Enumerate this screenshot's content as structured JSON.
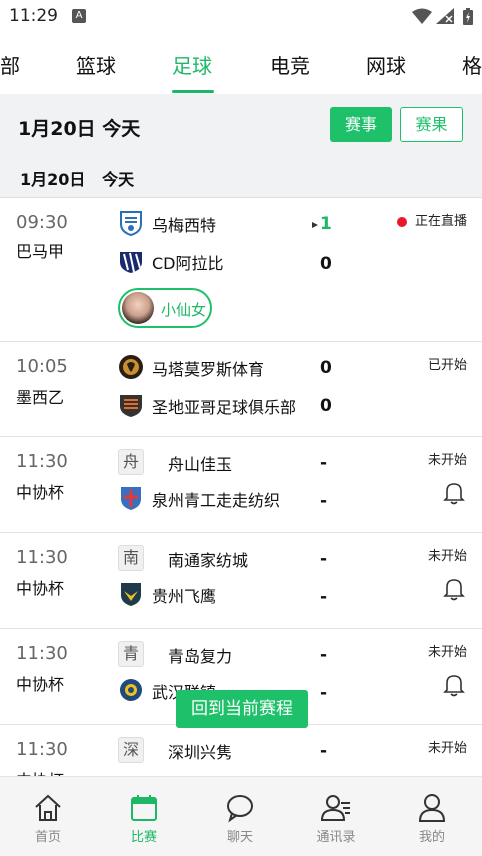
{
  "status_bar": {
    "time": "11:29",
    "notif_icon": "A"
  },
  "sport_tabs": [
    {
      "label": "部",
      "active": false
    },
    {
      "label": "篮球",
      "active": false
    },
    {
      "label": "足球",
      "active": true
    },
    {
      "label": "电竞",
      "active": false
    },
    {
      "label": "网球",
      "active": false
    },
    {
      "label": "格",
      "active": false
    }
  ],
  "date_header": {
    "date": "1月20日 今天",
    "events_button": "赛事",
    "results_button": "赛果"
  },
  "sub_date": "1月20日   今天",
  "matches": [
    {
      "time": "09:30",
      "league": "巴马甲",
      "home": {
        "name": "乌梅西特",
        "logo": "shield-logo"
      },
      "away": {
        "name": "CD阿拉比",
        "logo": "striped-logo"
      },
      "home_score": "1",
      "away_score": "0",
      "status": "正在直播",
      "live": true,
      "streamer": "小仙女"
    },
    {
      "time": "10:05",
      "league": "墨西乙",
      "home": {
        "name": "马塔莫罗斯体育",
        "logo": "lion-logo"
      },
      "away": {
        "name": "圣地亚哥足球俱乐部",
        "logo": "crest-logo"
      },
      "home_score": "0",
      "away_score": "0",
      "status": "已开始"
    },
    {
      "time": "11:30",
      "league": "中协杯",
      "home": {
        "name": "舟山佳玉",
        "logo_char": "舟"
      },
      "away": {
        "name": "泉州青工走走纺织",
        "logo": "crest-logo"
      },
      "home_score": "-",
      "away_score": "-",
      "status": "未开始"
    },
    {
      "time": "11:30",
      "league": "中协杯",
      "home": {
        "name": "南通家纺城",
        "logo_char": "南"
      },
      "away": {
        "name": "贵州飞鹰",
        "logo": "eagle-logo"
      },
      "home_score": "-",
      "away_score": "-",
      "status": "未开始"
    },
    {
      "time": "11:30",
      "league": "中协杯",
      "home": {
        "name": "青岛复力",
        "logo_char": "青"
      },
      "away": {
        "name": "武汉联镇",
        "logo": "circle-logo"
      },
      "home_score": "-",
      "away_score": "-",
      "status": "未开始"
    },
    {
      "time": "11:30",
      "league": "中协杯",
      "home": {
        "name": "深圳兴隽",
        "logo_char": "深"
      },
      "away": {
        "name": "",
        "logo": ""
      },
      "home_score": "-",
      "away_score": "",
      "status": "未开始"
    }
  ],
  "float_button": "回到当前赛程",
  "bottom_nav": [
    {
      "label": "首页",
      "icon": "home-icon"
    },
    {
      "label": "比赛",
      "icon": "calendar-icon",
      "active": true
    },
    {
      "label": "聊天",
      "icon": "chat-icon"
    },
    {
      "label": "通讯录",
      "icon": "contacts-icon"
    },
    {
      "label": "我的",
      "icon": "profile-icon"
    }
  ],
  "colors": {
    "accent": "#1fc06a",
    "live_dot": "#e8182a",
    "header_bg": "#f1f2f4"
  }
}
